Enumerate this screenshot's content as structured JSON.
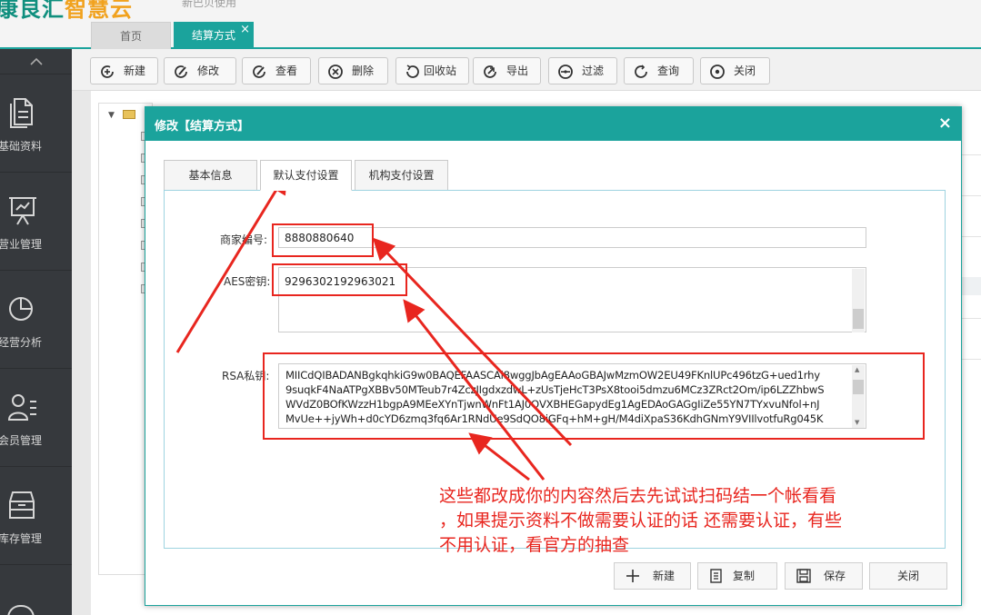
{
  "header": {
    "logo_main": "康良汇",
    "logo_accent": "智慧云",
    "crumb": "新巴贝使用"
  },
  "tabs": {
    "home": "首页",
    "active": "结算方式",
    "close": "×"
  },
  "sidebar": {
    "toggle": "^",
    "items": [
      {
        "label": "基础资料",
        "icon": "document-icon"
      },
      {
        "label": "营业管理",
        "icon": "presentation-icon"
      },
      {
        "label": "经营分析",
        "icon": "pie-chart-icon"
      },
      {
        "label": "会员管理",
        "icon": "member-icon"
      },
      {
        "label": "库存管理",
        "icon": "inventory-icon"
      }
    ]
  },
  "toolbar": {
    "buttons": [
      "新建",
      "修改",
      "查看",
      "删除",
      "回收站",
      "导出",
      "过滤",
      "查询",
      "关闭"
    ]
  },
  "modal": {
    "title": "修改【结算方式】",
    "close": "×",
    "tabs": [
      "基本信息",
      "默认支付设置",
      "机构支付设置"
    ],
    "fields": {
      "merchant_label": "商家编号:",
      "merchant_value": "8880880640",
      "aes_label": "AES密钥:",
      "aes_value": "9296302192963021",
      "rsa_label": "RSA私钥:",
      "rsa_lines": [
        "MIICdQIBADANBgkqhkiG9w0BAQEFAASCAl8wggJbAgEAAoGBAJwMzmOW2EU49FKnlUPc496tzG+ued1rhy",
        "9suqkF4NaATPgXBBv50MTeub7r4ZczJIgdxzdwL+zUsTjeHcT3PsX8tooi5dmzu6MCz3ZRct2Om/ip6LZZhbwS",
        "WVdZ0BOfKWzzH1bgpA9MEeXYnTjwnWnFt1AJ0QVXBHEGapydEg1AgEDAoGAGgIiZe55YN7TYxvuNfol+nJ",
        "MvUe++jyWh+d0cYD6zmq3fq6Ar1RNdUe9SdQO8iGFq+hM+gH/M4diXpaS36KdhGNmY9VIIlvotfuRg045K"
      ]
    },
    "footer": [
      "新建",
      "复制",
      "保存",
      "关闭"
    ]
  },
  "annotation": {
    "lines": [
      "这些都改成你的内容然后去先试试扫码结一个帐看看",
      "，如果提示资料不做需要认证的话 还需要认证，有些",
      "不用认证，看官方的抽查"
    ],
    "color": "#e8261f"
  },
  "theme": {
    "accent": "#1ba39c",
    "sidebar_bg": "#36393d"
  }
}
